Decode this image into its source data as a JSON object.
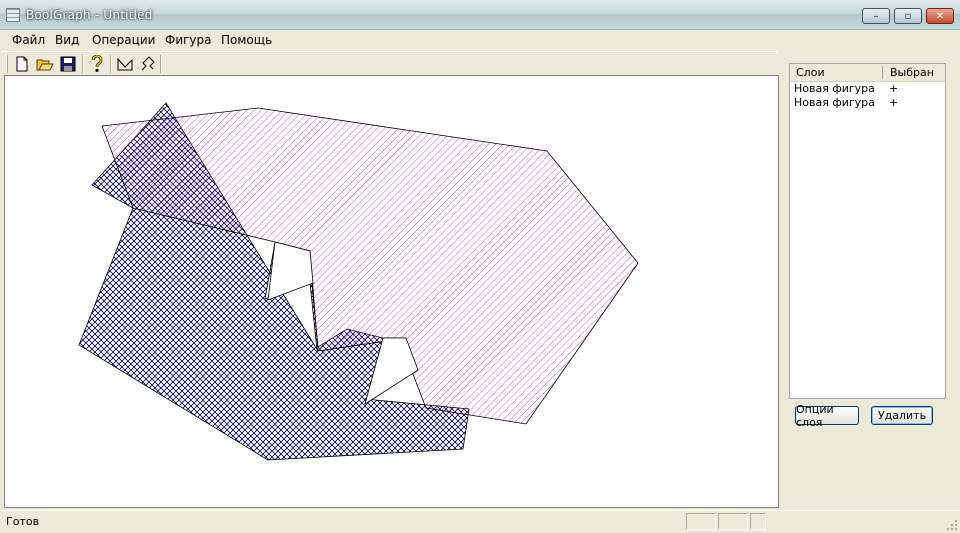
{
  "window": {
    "title": "BoolGraph - Untitled"
  },
  "window_buttons": {
    "minimize": "–",
    "maximize": "▫",
    "close": "✕"
  },
  "menu": [
    "Файл",
    "Вид",
    "Операции",
    "Фигура",
    "Помощь"
  ],
  "toolbar": {
    "buttons": [
      "new-icon",
      "open-icon",
      "save-icon",
      "help-icon",
      "shape-icon",
      "curve-icon"
    ]
  },
  "canvas": {
    "shapes": [
      {
        "name": "Новая фигура",
        "fill": "crosshatch",
        "color": "#000066"
      },
      {
        "name": "Новая фигура",
        "fill": "diagonal-hatch",
        "color": "#c040c0"
      }
    ]
  },
  "layers": {
    "headers": {
      "name": "Слои",
      "selected": "Выбран"
    },
    "rows": [
      {
        "name": "Новая фигура",
        "selected": "+"
      },
      {
        "name": "Новая фигура",
        "selected": "+"
      }
    ],
    "buttons": {
      "options": "Опции слоя",
      "delete": "Удалить"
    }
  },
  "status": {
    "text": "Готов"
  }
}
